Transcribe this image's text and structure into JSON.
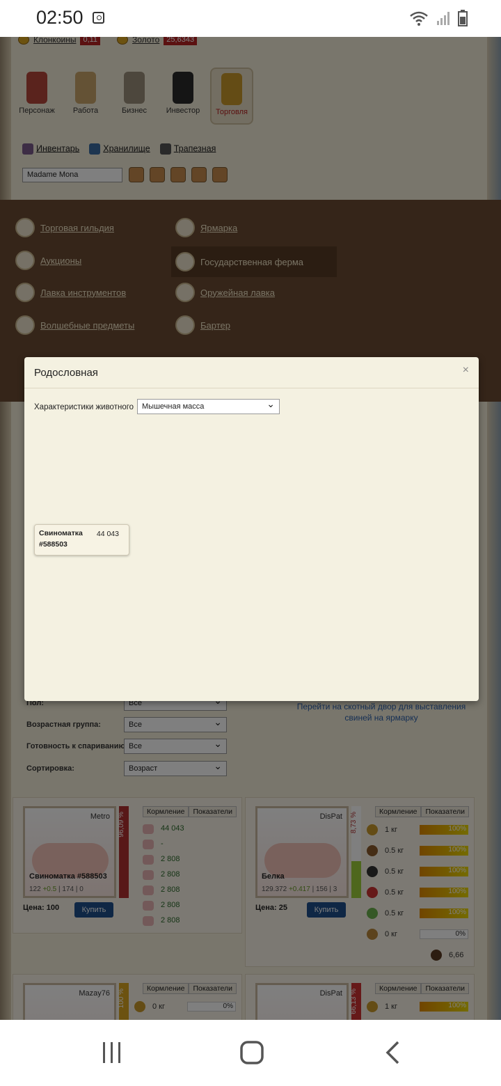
{
  "status_bar": {
    "time": "02:50"
  },
  "currency": {
    "clonecoins_label": "Клонкоины",
    "clonecoins_value": "0,11",
    "gold_label": "Золото",
    "gold_value": "25,6343"
  },
  "nav": {
    "items": [
      {
        "label": "Персонаж"
      },
      {
        "label": "Работа"
      },
      {
        "label": "Бизнес"
      },
      {
        "label": "Инвестор"
      },
      {
        "label": "Торговля"
      }
    ]
  },
  "sublinks": {
    "inventory": "Инвентарь",
    "storage": "Хранилище",
    "dining": "Трапезная"
  },
  "character_select": {
    "value": "Madame Mona"
  },
  "trade_menu": {
    "left": [
      "Торговая гильдия",
      "Аукционы",
      "Лавка инструментов",
      "Волшебные предметы"
    ],
    "right": [
      "Ярмарка",
      "Государственная ферма",
      "Оружейная лавка",
      "Бартер"
    ]
  },
  "filters": {
    "sex_label": "Пол:",
    "sex_value": "Все",
    "age_label": "Возрастная группа:",
    "age_value": "Все",
    "mating_label": "Готовность к спариванию:",
    "mating_value": "Все",
    "sort_label": "Сортировка:",
    "sort_value": "Возраст"
  },
  "farm_link": "Перейти на скотный двор для выставления свиней на ярмарку",
  "cards": [
    {
      "owner": "Metro",
      "gauge": "96,09 %",
      "name": "Свиноматка #588503",
      "stats_a": "122",
      "stats_b": "+0.5",
      "stats_c": "| 174 | 0",
      "price_label": "Цена:",
      "price": "100",
      "buy": "Купить",
      "tab1": "Кормление",
      "tab2": "Показатели",
      "values": [
        "44 043",
        "-",
        "2 808",
        "2 808",
        "2 808",
        "2 808",
        "2 808"
      ]
    },
    {
      "owner": "DisPat",
      "gauge": "8,73 %",
      "name": "Белка",
      "stats_a": "129.372",
      "stats_b": "+0.417",
      "stats_c": "| 156 | 3",
      "price_label": "Цена:",
      "price": "25",
      "buy": "Купить",
      "tab1": "Кормление",
      "tab2": "Показатели",
      "feed": [
        {
          "amount": "1 кг",
          "pct": "100%"
        },
        {
          "amount": "0.5 кг",
          "pct": "100%"
        },
        {
          "amount": "0.5 кг",
          "pct": "100%"
        },
        {
          "amount": "0.5 кг",
          "pct": "100%"
        },
        {
          "amount": "0.5 кг",
          "pct": "100%"
        },
        {
          "amount": "0 кг",
          "pct": "0%"
        }
      ],
      "extra": "6,66"
    },
    {
      "owner": "Mazay76",
      "gauge": "100 %",
      "tab1": "Кормление",
      "tab2": "Показатели",
      "feed_amount": "0 кг",
      "feed_pct": "0%"
    },
    {
      "owner": "DisPat",
      "gauge": "66,13 %",
      "tab1": "Кормление",
      "tab2": "Показатели",
      "feed_amount": "1 кг",
      "feed_pct": "100%"
    }
  ],
  "modal": {
    "title": "Родословная",
    "close": "×",
    "characteristic_label": "Характеристики животного",
    "characteristic_value": "Мышечная масса",
    "node": {
      "name_line1": "Свиноматка",
      "name_line2": "#588503",
      "value": "44 043"
    }
  }
}
